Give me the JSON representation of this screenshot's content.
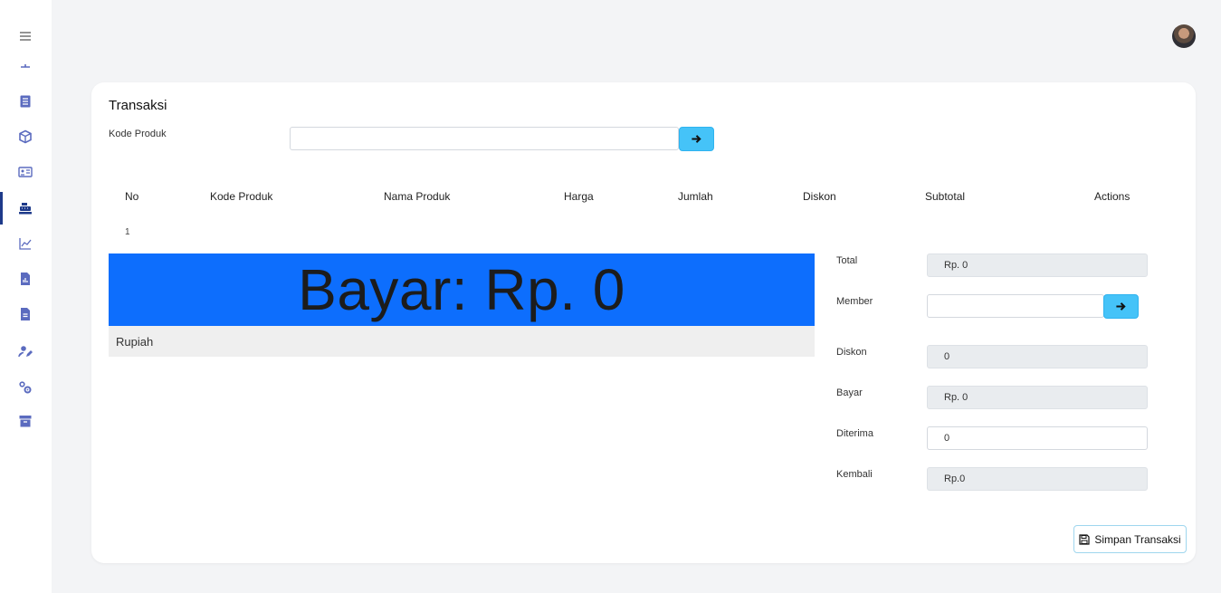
{
  "sidebar": {
    "icons": [
      "menu-icon",
      "monitor-icon",
      "list-icon",
      "box-icon",
      "id-card-icon",
      "cash-register-icon",
      "chart-line-icon",
      "file-chart-icon",
      "file-text-icon",
      "user-edit-icon",
      "gears-icon",
      "archive-icon"
    ],
    "accent": "#5b6bbf",
    "active_color": "#1e3a8a"
  },
  "card": {
    "title": "Transaksi",
    "kode_produk_label": "Kode Produk",
    "kode_produk_value": ""
  },
  "table": {
    "headers": [
      "No",
      "Kode Produk",
      "Nama Produk",
      "Harga",
      "Jumlah",
      "Diskon",
      "Subtotal",
      "Actions"
    ],
    "rows": [
      {
        "no": "1"
      }
    ]
  },
  "bayar_display": {
    "text": "Bayar: Rp. 0",
    "words": "Rupiah",
    "bg": "#0d6efd"
  },
  "summary": {
    "total_label": "Total",
    "total_value": "Rp. 0",
    "member_label": "Member",
    "member_value": "",
    "diskon_label": "Diskon",
    "diskon_value": "0",
    "bayar_label": "Bayar",
    "bayar_value": "Rp. 0",
    "diterima_label": "Diterima",
    "diterima_value": "0",
    "kembali_label": "Kembali",
    "kembali_value": "Rp.0"
  },
  "actions": {
    "save_label": "Simpan Transaksi"
  }
}
